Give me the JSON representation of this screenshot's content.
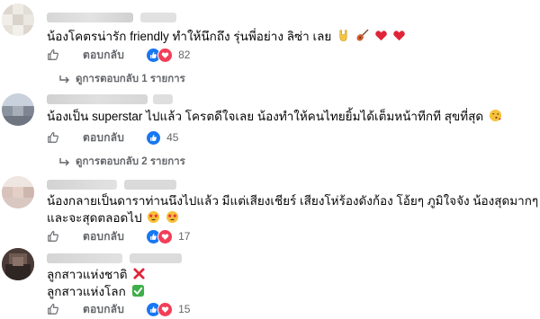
{
  "comments": [
    {
      "text": "น้องโคตรน่ารัก friendly ทำให้นึกถึง รุ่นพี่อย่าง ลิซ่า เลย",
      "reply_label": "ตอบกลับ",
      "reaction_count": "82",
      "view_replies": "ดูการตอบกลับ 1 รายการ"
    },
    {
      "text": "น้องเป็น superstar ไปแล้ว โครตดีใจเลย น้องทำให้คนไทยยิ้มได้เต็มหน้าทีกที สุขที่สุด",
      "reply_label": "ตอบกลับ",
      "reaction_count": "45",
      "view_replies": "ดูการตอบกลับ 2 รายการ"
    },
    {
      "text_line1": "น้องกลายเป็นดาราท่านนึงไปแล้ว มีแต่เสียงเชียร์ เสียงโห่ร้องดังก้อง โอ้ยๆ ภูมิใจจัง น้องสุดมากๆ",
      "text_line2": "และจะสุดตลอดไป",
      "reply_label": "ตอบกลับ",
      "reaction_count": "17"
    },
    {
      "text_line1": "ลูกสาวแห่งชาติ",
      "text_line2": "ลูกสาวแห่งโลก",
      "reply_label": "ตอบกลับ",
      "reaction_count": "15"
    }
  ],
  "icons": {
    "like": "like-outline-icon",
    "reaction_like": "like-reaction-icon",
    "reaction_love": "love-reaction-icon",
    "reply_arrow": "reply-arrow-icon"
  },
  "colors": {
    "like_blue": "#1877f2",
    "love_red": "#f33e58",
    "muted_text": "#65676b"
  }
}
